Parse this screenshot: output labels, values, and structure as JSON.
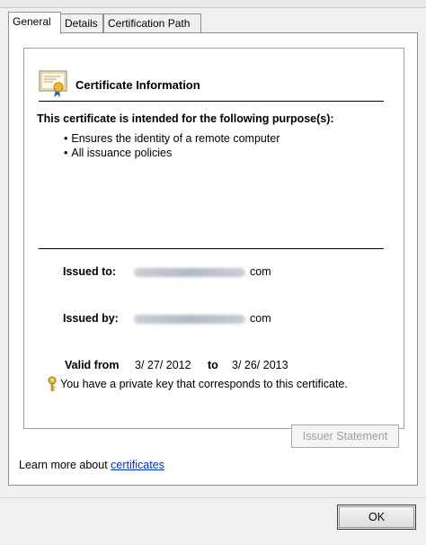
{
  "tabs": [
    {
      "label": "General",
      "active": true
    },
    {
      "label": "Details",
      "active": false
    },
    {
      "label": "Certification Path",
      "active": false
    }
  ],
  "certificate": {
    "title": "Certificate Information",
    "purpose_heading": "This certificate is intended for the following purpose(s):",
    "purposes": [
      "Ensures the identity of a remote computer",
      "All issuance policies"
    ],
    "issued_to_label": "Issued to:",
    "issued_to_suffix": "com",
    "issued_by_label": "Issued by:",
    "issued_by_suffix": "com",
    "valid_from_label": "Valid from",
    "valid_from": "3/ 27/ 2012",
    "to_label": "to",
    "valid_to": "3/ 26/ 2013",
    "private_key_note": "You have a private key that corresponds to this certificate."
  },
  "buttons": {
    "issuer_statement": "Issuer Statement",
    "ok": "OK"
  },
  "footer": {
    "learn_more_prefix": "Learn more about",
    "learn_more_link": "certificates"
  },
  "colors": {
    "link": "#0033cc",
    "panel_bg": "#ffffff",
    "window_bg": "#f0f0f0"
  },
  "icons": {
    "certificate": "certificate-icon",
    "key": "key-icon"
  }
}
